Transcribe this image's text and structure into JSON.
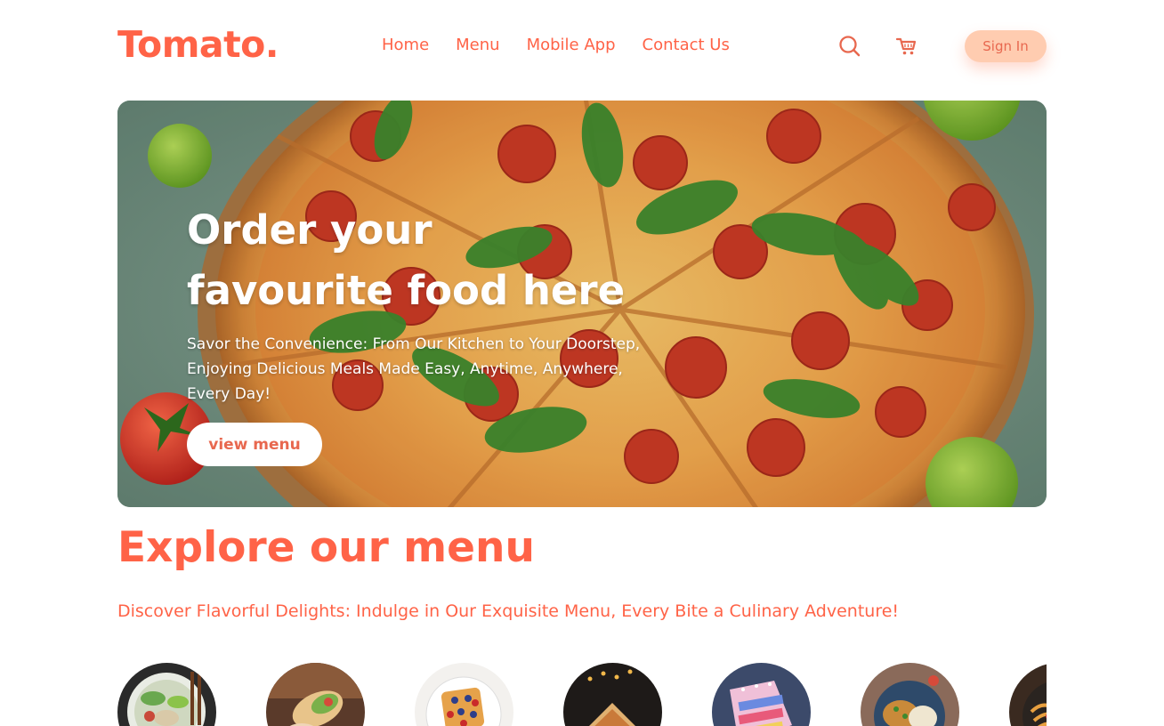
{
  "brand": {
    "logo": "Tomato.",
    "accent": "#ff6347"
  },
  "nav": {
    "items": [
      {
        "label": "Home"
      },
      {
        "label": "Menu"
      },
      {
        "label": "Mobile App"
      },
      {
        "label": "Contact Us"
      }
    ],
    "search_icon": "search-icon",
    "cart_icon": "cart-icon",
    "signin_label": "Sign In"
  },
  "hero": {
    "title_line1": "Order your",
    "title_line2": "favourite food here",
    "description": "Savor the Convenience: From Our Kitchen to Your Doorstep, Enjoying Delicious Meals Made Easy, Anytime, Anywhere, Every Day!",
    "button_label": "view menu"
  },
  "explore": {
    "title": "Explore our menu",
    "description": "Discover Flavorful Delights: Indulge in Our Exquisite Menu, Every Bite a Culinary Adventure!"
  },
  "menu_items": [
    {
      "image": "salad-image"
    },
    {
      "image": "rolls-image"
    },
    {
      "image": "dessert-waffle-image"
    },
    {
      "image": "sandwich-image"
    },
    {
      "image": "cake-image"
    },
    {
      "image": "pure-veg-image"
    },
    {
      "image": "pasta-image"
    }
  ]
}
